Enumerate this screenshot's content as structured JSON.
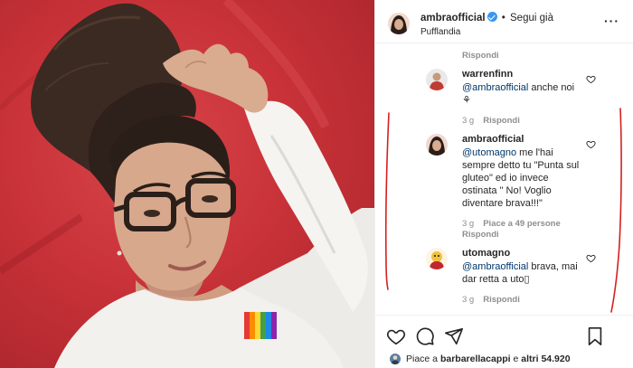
{
  "post": {
    "username": "ambraofficial",
    "follow_label": "Segui già",
    "separator": "•",
    "location": "Pufflandia",
    "more_icon": "more-horizontal-icon"
  },
  "comments": {
    "top_reply": "Rispondi",
    "items": [
      {
        "username": "warrenfinn",
        "mention": "@ambraofficial",
        "text": " anche noi",
        "emoji": "⚘",
        "time": "3 g",
        "likes": "",
        "reply": "Rispondi"
      },
      {
        "username": "ambraofficial",
        "mention": "@utomagno",
        "text": " me l'hai sempre detto tu \"Punta sul gluteo\" ed io invece ostinata \" No! Voglio diventare brava!!!\"",
        "time": "3 g",
        "likes": "Piace a 49 persone",
        "reply": "Rispondi"
      },
      {
        "username": "utomagno",
        "mention": "@ambraofficial",
        "text": " brava, mai dar retta a uto▯",
        "time": "3 g",
        "likes": "",
        "reply": "Rispondi"
      }
    ]
  },
  "footer": {
    "likes_prefix": "Piace a ",
    "likes_user": "barbarellacappi",
    "likes_middle": " e ",
    "likes_others": "altri 54.920"
  },
  "colors": {
    "mention": "#00376b",
    "verified": "#3897f0",
    "muted": "#8e8e8e",
    "photo_bg": "#c83238",
    "annotation": "#d42020"
  }
}
